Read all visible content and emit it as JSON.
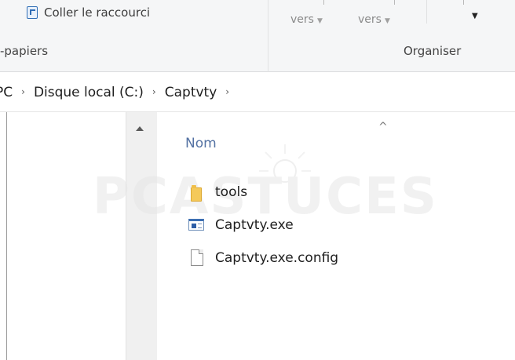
{
  "ribbon": {
    "paste_shortcut_label": "Coller le raccourci",
    "move_to_label": "vers",
    "copy_to_label": "vers",
    "clipboard_group_label": "-papiers",
    "organize_group_label": "Organiser",
    "dropdown_glyph": "▼"
  },
  "breadcrumb": {
    "items": [
      "PC",
      "Disque local (C:)",
      "Captvty"
    ],
    "separator": "›"
  },
  "file_list": {
    "column_name": "Nom",
    "items": [
      {
        "name": "tools",
        "type": "folder-icon"
      },
      {
        "name": "Captvty.exe",
        "type": "exe-icon"
      },
      {
        "name": "Captvty.exe.config",
        "type": "document-icon"
      }
    ]
  },
  "watermark": {
    "text": "PCASTUCES"
  },
  "colors": {
    "header_text": "#5472a3",
    "ribbon_bg": "#f5f6f7",
    "folder": "#f4c95a"
  }
}
